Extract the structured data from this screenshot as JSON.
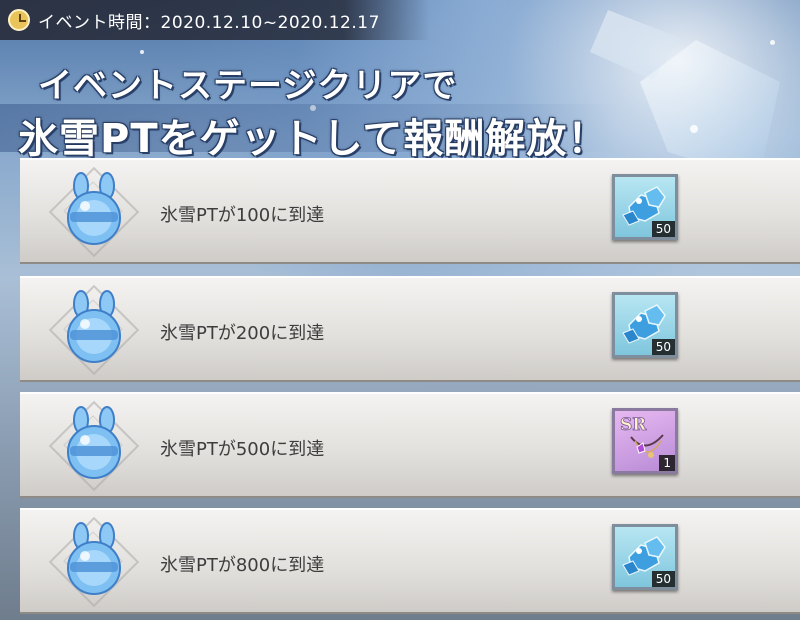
{
  "event": {
    "time_label": "イベント時間：2020.12.10~2020.12.17",
    "clock_icon": "clock-icon"
  },
  "headline": {
    "line1": "イベントステージクリアで",
    "line2": "氷雪PTをゲットして報酬解放！"
  },
  "rewards": [
    {
      "label": "氷雪PTが100に到達",
      "icon": "ice-bunny-icon",
      "item_icon": "ice-crystal-icon",
      "quantity": "50"
    },
    {
      "label": "氷雪PTが200に到達",
      "icon": "ice-bunny-icon",
      "item_icon": "ice-crystal-icon",
      "quantity": "50"
    },
    {
      "label": "氷雪PTが500に到達",
      "icon": "ice-bunny-icon",
      "item_icon": "sr-necklace-icon",
      "quantity": "1",
      "rarity": "SR"
    },
    {
      "label": "氷雪PTが800に到達",
      "icon": "ice-bunny-icon",
      "item_icon": "ice-crystal-icon",
      "quantity": "50"
    }
  ],
  "colors": {
    "row_bg": "#e3e1de",
    "label_text": "#3d3d3d",
    "crystal_bg": "#7fc6dd",
    "sr_bg": "#b88ad6"
  }
}
